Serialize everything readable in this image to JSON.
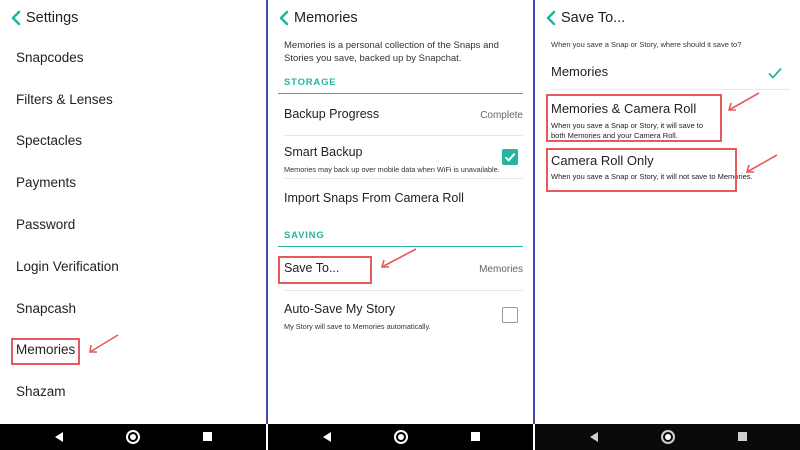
{
  "settings": {
    "title": "Settings",
    "items": [
      {
        "label": "Snapcodes"
      },
      {
        "label": "Filters & Lenses"
      },
      {
        "label": "Spectacles"
      },
      {
        "label": "Payments"
      },
      {
        "label": "Password"
      },
      {
        "label": "Login Verification"
      },
      {
        "label": "Snapcash"
      },
      {
        "label": "Memories"
      },
      {
        "label": "Shazam"
      }
    ]
  },
  "memories": {
    "title": "Memories",
    "intro": "Memories is a personal collection of the Snaps and Stories you save, backed up by Snapchat.",
    "storage_header": "STORAGE",
    "backup_progress_label": "Backup Progress",
    "backup_progress_value": "Complete",
    "smart_backup_label": "Smart Backup",
    "smart_backup_desc": "Memories may back up over mobile data when WiFi is unavailable.",
    "smart_backup_checked": true,
    "import_label": "Import Snaps From Camera Roll",
    "saving_header": "SAVING",
    "save_to_label": "Save To...",
    "save_to_value": "Memories",
    "autosave_label": "Auto-Save My Story",
    "autosave_desc": "My Story will save to Memories automatically.",
    "autosave_checked": false
  },
  "save_to": {
    "title": "Save To...",
    "prompt": "When you save a Snap or Story, where should it save to?",
    "options": [
      {
        "label": "Memories",
        "desc": "",
        "selected": true
      },
      {
        "label": "Memories & Camera Roll",
        "desc": "When you save a Snap or Story, it will save to both Memories and your Camera Roll.",
        "selected": false
      },
      {
        "label": "Camera Roll Only",
        "desc": "When you save a Snap or Story, it will not save to Memories.",
        "selected": false
      }
    ]
  },
  "colors": {
    "accent": "#26b3a0",
    "highlight": "#e35b5b",
    "divider": "#3b4fa8",
    "navbar": "#000000"
  },
  "icons": {
    "back": "chevron-left-icon",
    "check": "checkmark-icon",
    "nav_back": "triangle-back-icon",
    "nav_home": "circle-home-icon",
    "nav_recent": "square-recents-icon"
  }
}
